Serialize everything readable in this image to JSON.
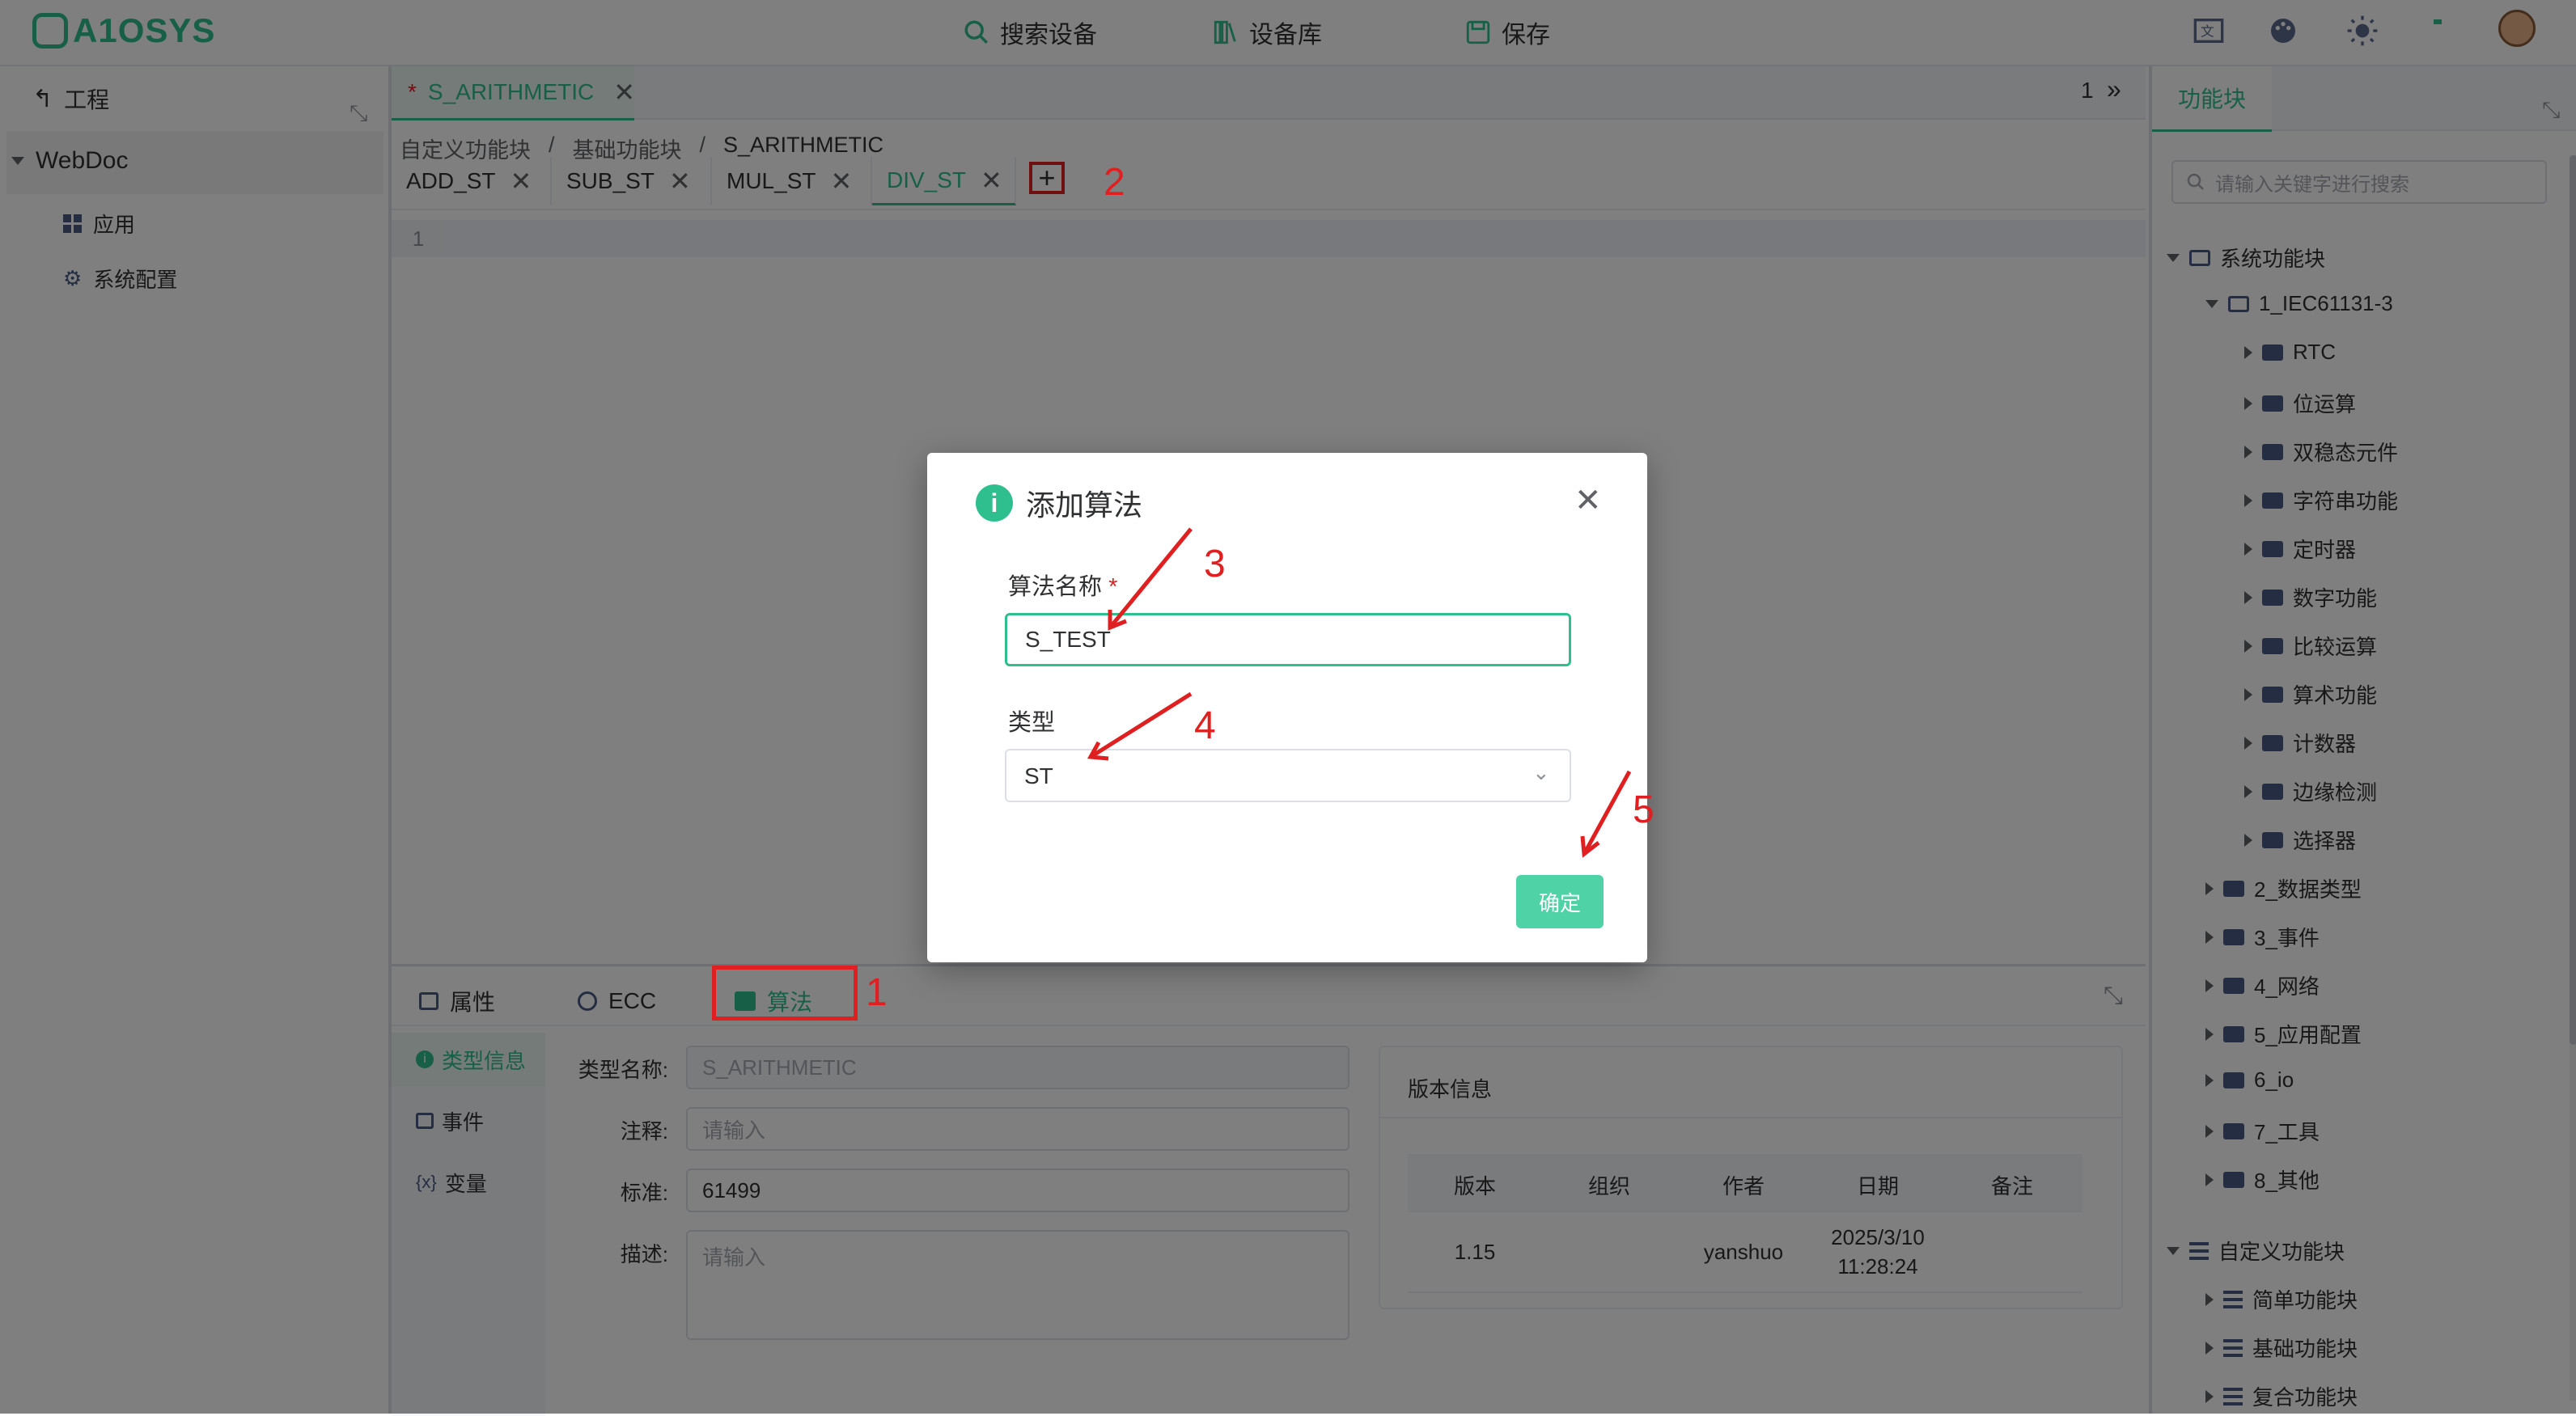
{
  "app": {
    "logo_text": "A1OSYS",
    "accent": "#2fbf8f"
  },
  "topnav": {
    "search": "搜索设备",
    "library": "设备库",
    "save": "保存"
  },
  "left_panel": {
    "header": "工程",
    "project": "WebDoc",
    "items": [
      {
        "label": "应用",
        "icon": "apps-icon"
      },
      {
        "label": "系统配置",
        "icon": "gear-icon"
      }
    ]
  },
  "editor": {
    "file_tab": "S_ARITHMETIC",
    "modified_mark": "*",
    "page_number": "1",
    "breadcrumb": [
      "自定义功能块",
      "基础功能块",
      "S_ARITHMETIC"
    ],
    "breadcrumb_sep": "/",
    "tabs": [
      "ADD_ST",
      "SUB_ST",
      "MUL_ST",
      "DIV_ST"
    ],
    "plus": "+",
    "line_number": "1"
  },
  "bottom_panel": {
    "tabs": [
      "属性",
      "ECC",
      "算法"
    ],
    "side_nav": [
      "类型信息",
      "事件",
      "变量"
    ],
    "fields": {
      "type_name_label": "类型名称:",
      "type_name_value": "S_ARITHMETIC",
      "comment_label": "注释:",
      "comment_placeholder": "请输入",
      "standard_label": "标准:",
      "standard_value": "61499",
      "desc_label": "描述:",
      "desc_placeholder": "请输入"
    },
    "version": {
      "title": "版本信息",
      "headers": [
        "版本",
        "组织",
        "作者",
        "日期",
        "备注"
      ],
      "row": {
        "version": "1.15",
        "org": "",
        "author": "yanshuo",
        "date_line1": "2025/3/10",
        "date_line2": "11:28:24",
        "note": ""
      }
    }
  },
  "right_panel": {
    "tab": "功能块",
    "search_placeholder": "请输入关键字进行搜索",
    "tree": {
      "system_root": "系统功能块",
      "iec": "1_IEC61131-3",
      "iec_children": [
        "RTC",
        "位运算",
        "双稳态元件",
        "字符串功能",
        "定时器",
        "数字功能",
        "比较运算",
        "算术功能",
        "计数器",
        "边缘检测",
        "选择器"
      ],
      "system_children": [
        "2_数据类型",
        "3_事件",
        "4_网络",
        "5_应用配置",
        "6_io",
        "7_工具",
        "8_其他"
      ],
      "custom_root": "自定义功能块",
      "custom_children": [
        "简单功能块",
        "基础功能块",
        "复合功能块"
      ]
    }
  },
  "modal": {
    "title": "添加算法",
    "name_label": "算法名称",
    "required_mark": "*",
    "name_value": "S_TEST",
    "type_label": "类型",
    "type_value": "ST",
    "confirm": "确定"
  },
  "annotations": [
    "1",
    "2",
    "3",
    "4",
    "5"
  ]
}
